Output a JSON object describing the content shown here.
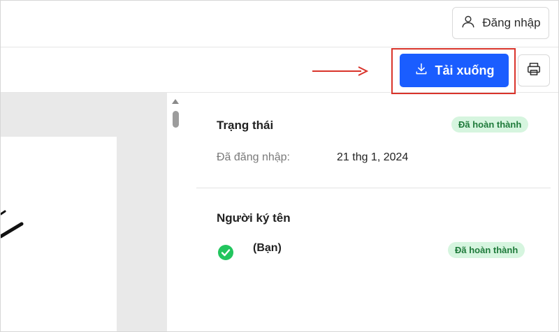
{
  "header": {
    "login_label": "Đăng nhập",
    "login_icon": "user-icon"
  },
  "toolbar": {
    "download_label": "Tải xuống",
    "download_icon": "download-icon",
    "print_icon": "printer-icon",
    "accent_color": "#1a5dff",
    "highlight_color": "#d9342b"
  },
  "status": {
    "title": "Trạng thái",
    "badge": "Đã hoàn thành",
    "label": "Đã đăng nhập:",
    "value": "21 thg 1, 2024"
  },
  "signers": {
    "title": "Người ký tên",
    "items": [
      {
        "name": "(Bạn)",
        "status": "Đã hoàn thành",
        "icon": "check-circle-icon"
      }
    ]
  }
}
